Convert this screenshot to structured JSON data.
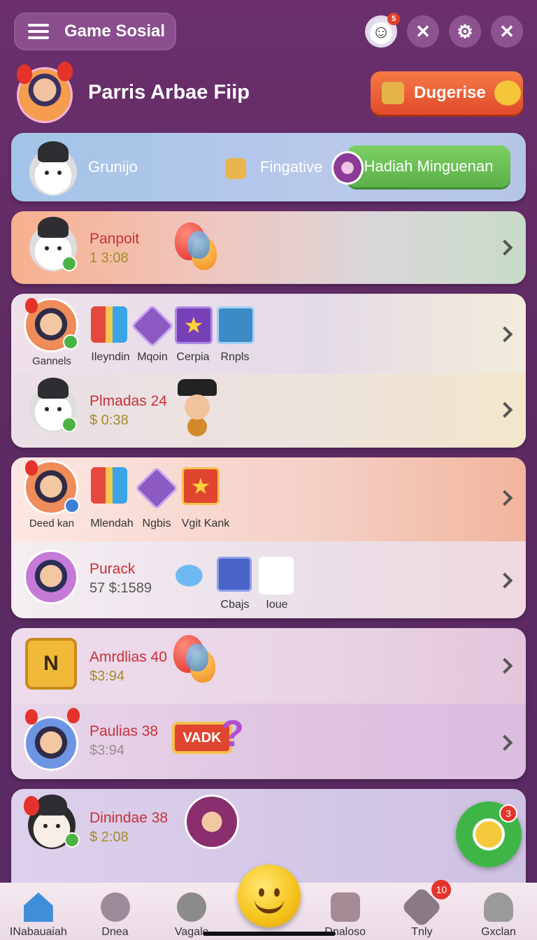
{
  "header": {
    "app_title": "Game Sosial",
    "profile_name": "Parris Arbae Fiip",
    "cta_label": "Dugerise",
    "notif_badge": "5"
  },
  "group_card": {
    "name": "Grunijo",
    "mid_label": "Fingative",
    "green_button": "Hadiah Minguenan"
  },
  "rows": [
    {
      "title": "Panpoit",
      "sub": "1 3:08"
    },
    {
      "avatar_label": "Gannels",
      "items": [
        "Ileyndin",
        "Mqoin",
        "Cerpia",
        "Rnpls"
      ]
    },
    {
      "title": "Plmadas 24",
      "sub": "$ 0:38"
    },
    {
      "avatar_label": "Deed kan",
      "items": [
        "Mlendah",
        "Ngbis",
        "Vgit Kank"
      ]
    },
    {
      "title": "Purack",
      "sub": "57   $:1589",
      "items": [
        "Cbajs",
        "Ioue"
      ]
    },
    {
      "title": "Amrdlias 40",
      "sub": "$3:94"
    },
    {
      "title": "Paulias 38",
      "sub": "$3:94",
      "badge_text": "VADK"
    },
    {
      "title": "Dinindae 38",
      "sub": "$ 2:08"
    }
  ],
  "chat_badge": "3",
  "bottom_nav": [
    {
      "label": "INabauaiah",
      "icon": "home-icon"
    },
    {
      "label": "Dnea",
      "icon": "orb-icon"
    },
    {
      "label": "Vagale",
      "icon": "gear-icon"
    },
    {
      "label": "Dnaloso",
      "icon": "mail-icon"
    },
    {
      "label": "Tnly",
      "icon": "diamond-icon",
      "badge": "10"
    },
    {
      "label": "Gxclan",
      "icon": "person-icon"
    }
  ]
}
